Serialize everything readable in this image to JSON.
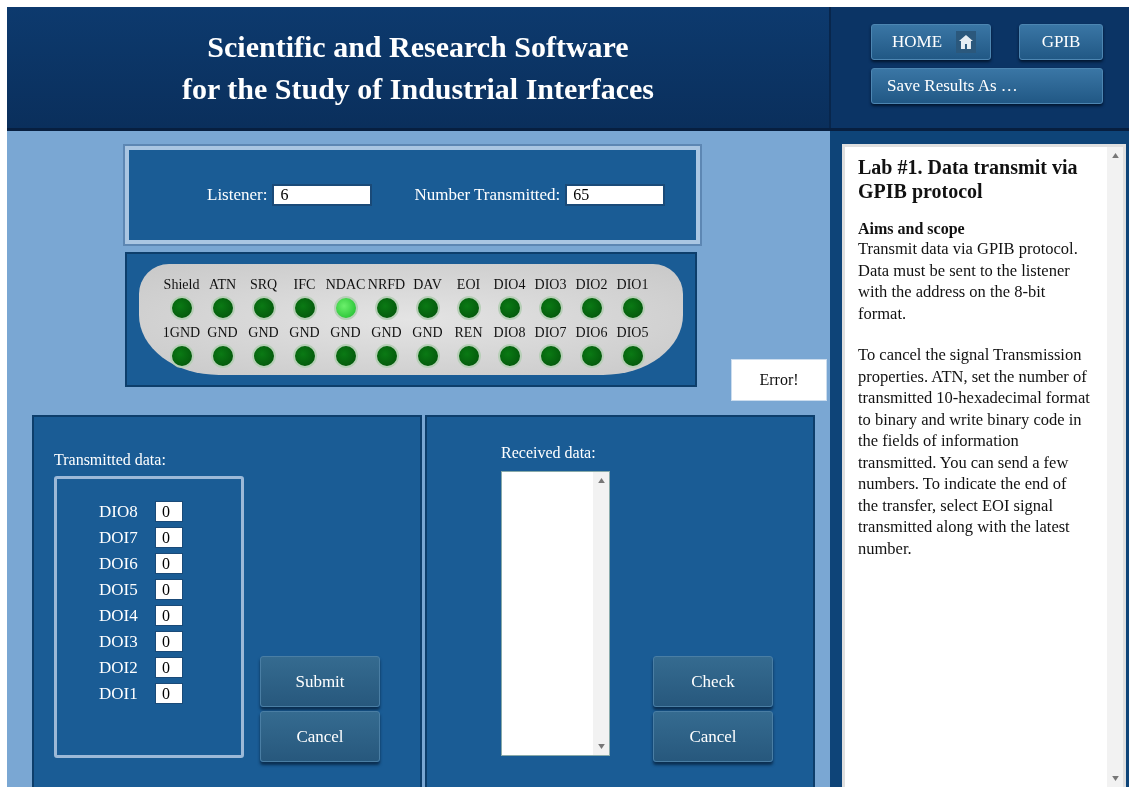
{
  "header": {
    "title_lines": [
      "Scientific and Research Software",
      "for the Study of Industrial Interfaces"
    ]
  },
  "nav": {
    "home": "HOME",
    "gpib": "GPIB",
    "save": "Save Results As …"
  },
  "settings": {
    "listener_label": "Listener:",
    "listener_value": "6",
    "number_label": "Number Transmitted:",
    "number_value": "65"
  },
  "connector": {
    "top_row": [
      {
        "label": "Shield",
        "on": false
      },
      {
        "label": "ATN",
        "on": false
      },
      {
        "label": "SRQ",
        "on": false
      },
      {
        "label": "IFC",
        "on": false
      },
      {
        "label": "NDAC",
        "on": true
      },
      {
        "label": "NRFD",
        "on": false
      },
      {
        "label": "DAV",
        "on": false
      },
      {
        "label": "EOI",
        "on": false
      },
      {
        "label": "DIO4",
        "on": false
      },
      {
        "label": "DIO3",
        "on": false
      },
      {
        "label": "DIO2",
        "on": false
      },
      {
        "label": "DIO1",
        "on": false
      }
    ],
    "bottom_row": [
      {
        "label": "1GND",
        "on": false
      },
      {
        "label": "GND",
        "on": false
      },
      {
        "label": "GND",
        "on": false
      },
      {
        "label": "GND",
        "on": false
      },
      {
        "label": "GND",
        "on": false
      },
      {
        "label": "GND",
        "on": false
      },
      {
        "label": "GND",
        "on": false
      },
      {
        "label": "REN",
        "on": false
      },
      {
        "label": "DIO8",
        "on": false
      },
      {
        "label": "DIO7",
        "on": false
      },
      {
        "label": "DIO6",
        "on": false
      },
      {
        "label": "DIO5",
        "on": false
      }
    ]
  },
  "error_label": "Error!",
  "transmitted": {
    "title": "Transmitted data:",
    "bits": [
      {
        "label": "DIO8",
        "value": "0"
      },
      {
        "label": "DOI7",
        "value": "0"
      },
      {
        "label": "DOI6",
        "value": "0"
      },
      {
        "label": "DOI5",
        "value": "0"
      },
      {
        "label": "DOI4",
        "value": "0"
      },
      {
        "label": "DOI3",
        "value": "0"
      },
      {
        "label": "DOI2",
        "value": "0"
      },
      {
        "label": "DOI1",
        "value": "0"
      }
    ],
    "buttons": [
      "Submit",
      "Cancel"
    ]
  },
  "received": {
    "title": "Received data:",
    "buttons": [
      "Check",
      "Cancel"
    ]
  },
  "instructions": {
    "title": "Lab #1. Data transmit via GPIB protocol",
    "heading": "Aims and scope",
    "paragraphs": [
      "Transmit data via GPIB protocol. Data must be sent to the listener with the address on the 8-bit format.",
      "To cancel the signal Transmission properties. ATN, set the number of transmitted 10-hexadecimal format to binary and write binary code in the fields of information transmitted. You can send a few numbers. To indicate the end of the transfer, select EOI signal transmitted along with the latest number."
    ]
  }
}
